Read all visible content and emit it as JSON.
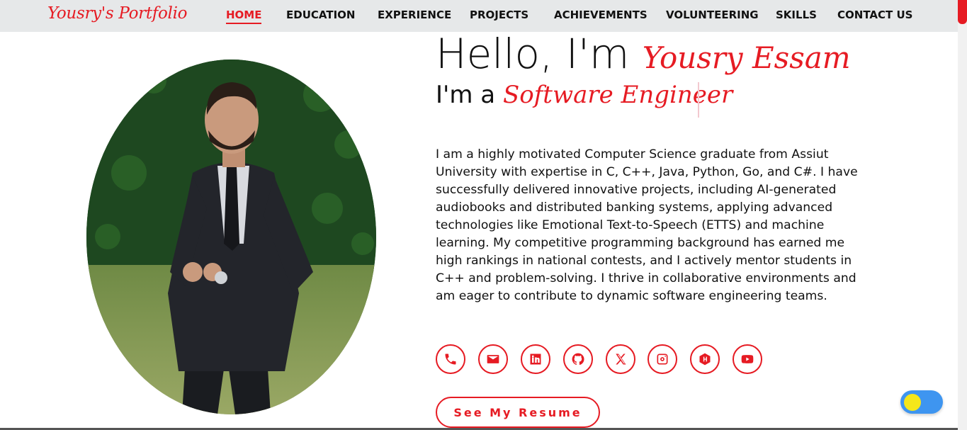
{
  "brand": "Yousry's Portfolio",
  "nav": {
    "items": [
      "HOME",
      "EDUCATION",
      "EXPERIENCE",
      "PROJECTS",
      "ACHIEVEMENTS",
      "VOLUNTEERING",
      "SKILLS",
      "CONTACT US"
    ],
    "active": "HOME"
  },
  "hero": {
    "greeting": "Hello, I'm",
    "name": "Yousry Essam",
    "role_prefix": "I'm a",
    "role": "Software Engineer",
    "bio": "I am a highly motivated Computer Science graduate from Assiut University with expertise in C, C++, Java, Python, Go, and C#. I have successfully delivered innovative projects, including AI-generated audiobooks and distributed banking systems, applying advanced technologies like Emotional Text-to-Speech (ETTS) and machine learning. My competitive programming background has earned me high rankings in national contests, and I actively mentor students in C++ and problem-solving. I thrive in collaborative environments and am eager to contribute to dynamic software engineering teams."
  },
  "social_icons": [
    "phone-icon",
    "email-icon",
    "linkedin-icon",
    "github-icon",
    "x-icon",
    "instagram-icon",
    "hackerrank-icon",
    "youtube-icon"
  ],
  "resume_button": "See My Resume",
  "colors": {
    "accent": "#e61b23",
    "navbar": "#e6e8e9",
    "toggle": "#3e95f0",
    "toggle_knob": "#f5e71a"
  },
  "theme_toggle": {
    "state": "on"
  }
}
